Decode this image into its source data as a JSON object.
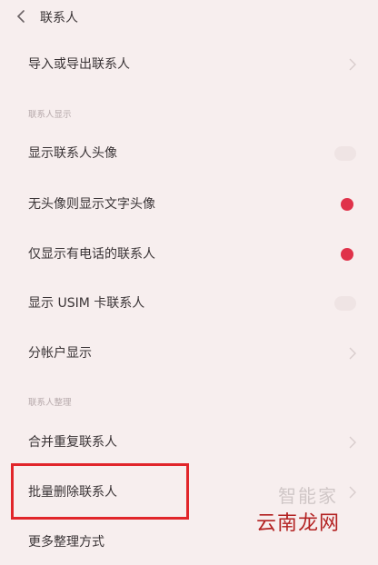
{
  "header": {
    "title": "联系人"
  },
  "rows": {
    "import_export": "导入或导出联系人",
    "show_avatar": "显示联系人头像",
    "text_avatar": "无头像则显示文字头像",
    "only_phone": "仅显示有电话的联系人",
    "show_usim": "显示 USIM 卡联系人",
    "by_account": "分帐户显示",
    "merge_dup": "合并重复联系人",
    "batch_delete": "批量删除联系人",
    "more_tidy": "更多整理方式"
  },
  "sections": {
    "display": "联系人显示",
    "organize": "联系人整理"
  },
  "watermark": {
    "brand": "云南龙网",
    "faint": "智能家"
  },
  "colors": {
    "accent_red": "#e0324a",
    "highlight_red": "#e1252a",
    "background": "#f7eeee"
  }
}
